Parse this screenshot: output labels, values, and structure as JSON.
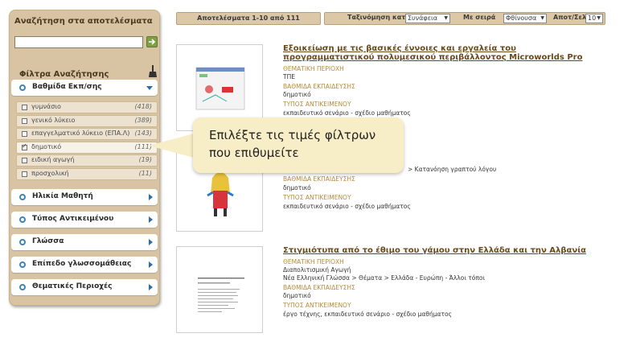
{
  "sidebar": {
    "search_title": "Αναζήτηση στα αποτελέσματα",
    "search_value": "",
    "filters_title": "Φίλτρα Αναζήτησης",
    "expanded_category": "Βαθμίδα Εκπ/σης",
    "options": [
      {
        "label": "γυμνάσιο",
        "count": "(418)",
        "checked": false
      },
      {
        "label": "γενικό λύκειο",
        "count": "(389)",
        "checked": false
      },
      {
        "label": "επαγγελματικό λύκειο (ΕΠΑ.Λ)",
        "count": "(143)",
        "checked": false
      },
      {
        "label": "δημοτικό",
        "count": "(111)",
        "checked": true
      },
      {
        "label": "ειδική αγωγή",
        "count": "(19)",
        "checked": false
      },
      {
        "label": "προσχολική",
        "count": "(11)",
        "checked": false
      }
    ],
    "categories": [
      "Ηλικία Μαθητή",
      "Τύπος Αντικειμένου",
      "Γλώσσα",
      "Επίπεδο γλωσσομάθειας",
      "Θεματικές Περιοχές"
    ]
  },
  "topbar": {
    "results_label": "Αποτελέσματα 1-10 από 111",
    "sort_label": "Ταξινόμηση κατά",
    "sort_value": "Συνάφεια",
    "order_label": "Με σειρά",
    "order_value": "Φθίνουσα",
    "per_page_label": "Αποτ/Σελ",
    "per_page_value": "10"
  },
  "results": [
    {
      "title": "Εξοικείωση με τις βασικές έννοιες και εργαλεία του προγραμματιστικού πολυμεσικού περιβάλλοντος Microworlds Pro",
      "area_label": "ΘΕΜΑΤΙΚΗ ΠΕΡΙΟΧΗ",
      "area_value": "ΤΠΕ",
      "level_label": "ΒΑΘΜΙΔΑ ΕΚΠΑΙΔΕΥΣΗΣ",
      "level_value": "δημοτικό",
      "type_label": "ΤΥΠΟΣ ΑΝΤΙΚΕΙΜΕΝΟΥ",
      "type_value": "εκπαιδευτικό σενάριο - σχέδιο μαθήματος"
    },
    {
      "area_value_extra": "> Κατανόηση γραπτού λόγου",
      "level_label": "ΒΑΘΜΙΔΑ ΕΚΠΑΙΔΕΥΣΗΣ",
      "level_value": "δημοτικό",
      "type_label": "ΤΥΠΟΣ ΑΝΤΙΚΕΙΜΕΝΟΥ",
      "type_value": "εκπαιδευτικό σενάριο - σχέδιο μαθήματος"
    },
    {
      "title": "Στιγμιότυπα από το έθιμο του γάμου στην Ελλάδα και την Αλβανία",
      "area_label": "ΘΕΜΑΤΙΚΗ ΠΕΡΙΟΧΗ",
      "area_value": "Διαπολιτισμική Αγωγή",
      "area_value2": "Νέα Ελληνική Γλώσσα > Θέματα > Ελλάδα - Ευρώπη - Άλλοι τόποι",
      "level_label": "ΒΑΘΜΙΔΑ ΕΚΠΑΙΔΕΥΣΗΣ",
      "level_value": "δημοτικό",
      "type_label": "ΤΥΠΟΣ ΑΝΤΙΚΕΙΜΕΝΟΥ",
      "type_value": "έργο τέχνης, εκπαιδευτικό σενάριο - σχέδιο μαθήματος"
    }
  ],
  "tooltip": {
    "line1": "Επιλέξτε τις τιμές φίλτρων",
    "line2": "που επιθυμείτε"
  },
  "colors": {
    "sidebar_bg": "#d8c4a3",
    "title_link": "#6b4a1a",
    "meta_key": "#b68b3c",
    "accent_blue": "#2d6fae",
    "tooltip_bg": "#f7edc6"
  }
}
